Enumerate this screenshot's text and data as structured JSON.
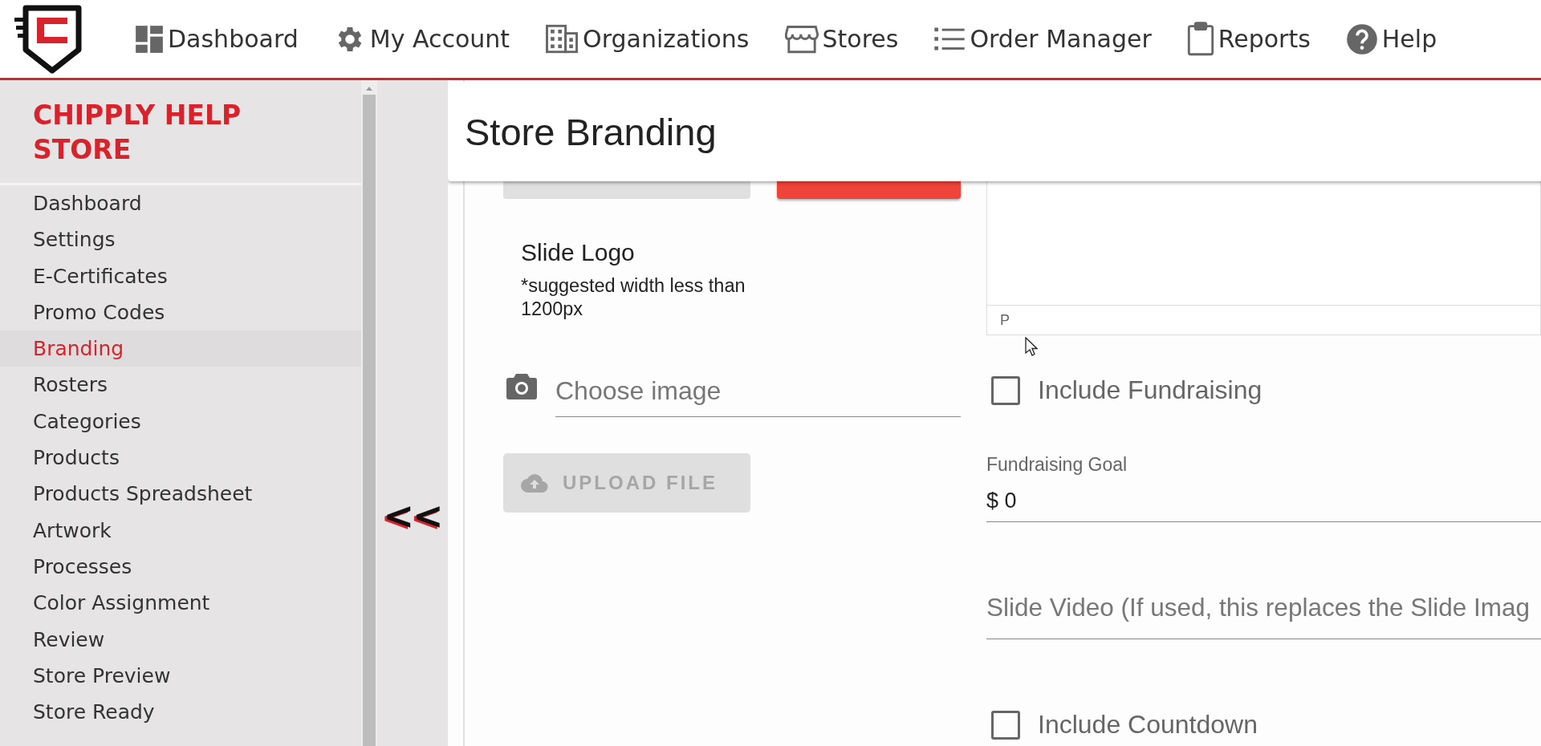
{
  "nav": {
    "items": [
      {
        "label": "Dashboard",
        "kind": "dashboard"
      },
      {
        "label": "My Account",
        "kind": "account"
      },
      {
        "label": "Organizations",
        "kind": "organizations"
      },
      {
        "label": "Stores",
        "kind": "stores"
      },
      {
        "label": "Order Manager",
        "kind": "orders"
      },
      {
        "label": "Reports",
        "kind": "reports"
      },
      {
        "label": "Help",
        "kind": "help"
      }
    ]
  },
  "sidebar": {
    "title": "CHIPPLY HELP STORE",
    "items": [
      {
        "label": "Dashboard",
        "selected": false
      },
      {
        "label": "Settings",
        "selected": false
      },
      {
        "label": "E-Certificates",
        "selected": false
      },
      {
        "label": "Promo Codes",
        "selected": false
      },
      {
        "label": "Branding",
        "selected": true
      },
      {
        "label": "Rosters",
        "selected": false
      },
      {
        "label": "Categories",
        "selected": false
      },
      {
        "label": "Products",
        "selected": false
      },
      {
        "label": "Products Spreadsheet",
        "selected": false
      },
      {
        "label": "Artwork",
        "selected": false
      },
      {
        "label": "Processes",
        "selected": false
      },
      {
        "label": "Color Assignment",
        "selected": false
      },
      {
        "label": "Review",
        "selected": false
      },
      {
        "label": "Store Preview",
        "selected": false
      },
      {
        "label": "Store Ready",
        "selected": false
      }
    ],
    "collapse_toggle": "<<"
  },
  "page": {
    "title": "Store Branding"
  },
  "slide_logo": {
    "title": "Slide Logo",
    "hint": "*suggested width less than 1200px",
    "file_field": {
      "placeholder": "Choose image"
    },
    "upload_button": {
      "label": "UPLOAD FILE",
      "disabled": true
    }
  },
  "editor": {
    "status_path": "P"
  },
  "fields": [
    {
      "kind": "checkbox",
      "label": "Include Fundraising",
      "checked": false
    },
    {
      "kind": "text",
      "label": "Fundraising Goal",
      "value": "$ 0"
    },
    {
      "kind": "text",
      "placeholder": "Slide Video (If used, this replaces the Slide Imag"
    },
    {
      "kind": "checkbox",
      "label": "Include Countdown",
      "checked": false
    }
  ]
}
